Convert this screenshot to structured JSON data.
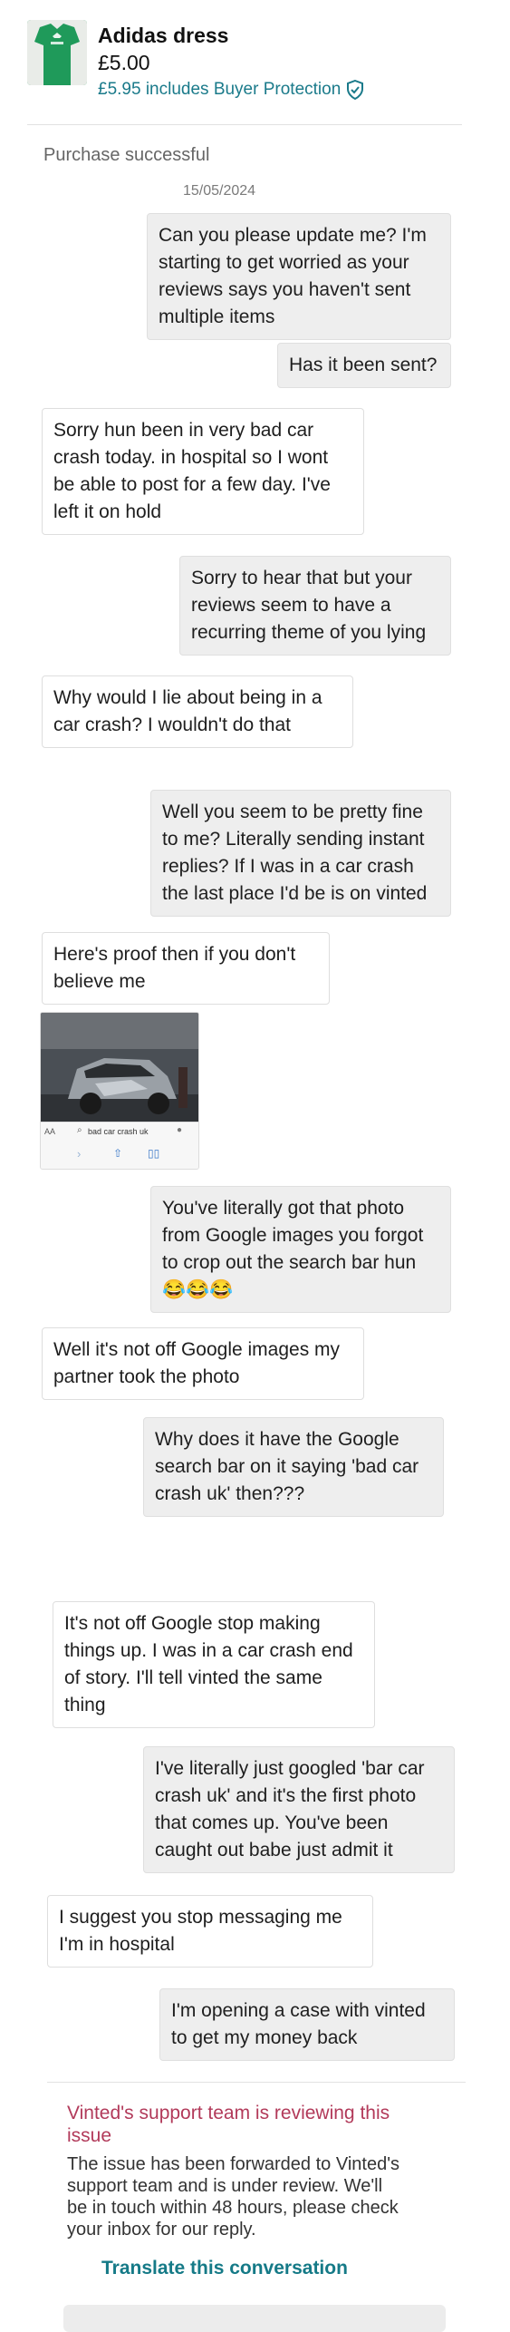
{
  "item": {
    "title": "Adidas dress",
    "price": "£5.00",
    "buyer_protection_text": "£5.95 includes Buyer Protection",
    "thumbnail_color": "#1f9a5a"
  },
  "status": "Purchase successful",
  "date": "15/05/2024",
  "messages": [
    {
      "side": "out",
      "lines": [
        "Can you please update me? I'm",
        "starting to get worried as your",
        "reviews says you haven't sent",
        "multiple items"
      ]
    },
    {
      "side": "out",
      "lines": [
        "Has it been sent?"
      ]
    },
    {
      "side": "in",
      "lines": [
        "Sorry hun been in very bad car",
        "crash today. in hospital so I wont",
        "be able to post for a few day. I've",
        "left it on hold"
      ]
    },
    {
      "side": "out",
      "lines": [
        "Sorry to hear that but your",
        "reviews seem to have a",
        "recurring theme of you lying"
      ]
    },
    {
      "side": "in",
      "lines": [
        "Why would I lie about being in a",
        "car crash? I wouldn't do that"
      ]
    },
    {
      "side": "out",
      "lines": [
        "Well you seem to be pretty fine",
        "to me? Literally sending instant",
        "replies? If I was in a car crash",
        "the last place I'd be is on vinted"
      ]
    },
    {
      "side": "in",
      "lines": [
        "Here's proof then if you don't",
        "believe me"
      ]
    },
    {
      "side": "out",
      "lines": [
        "You've literally got that photo",
        "from Google images you forgot",
        "to crop out the search bar hun",
        "😂😂😂"
      ]
    },
    {
      "side": "in",
      "lines": [
        "Well it's not off Google images my",
        "partner took the photo"
      ]
    },
    {
      "side": "out",
      "lines": [
        "Why does it have the Google",
        "search bar on it saying 'bad car",
        "crash uk' then???"
      ]
    },
    {
      "side": "in",
      "lines": [
        "It's not off Google stop making",
        "things up. I was in a car crash end",
        "of story. I'll tell vinted the same",
        "thing"
      ]
    },
    {
      "side": "out",
      "lines": [
        "I've literally just googled 'bar car",
        "crash uk' and it's the first photo",
        "that comes up. You've been",
        "caught out babe just admit it"
      ]
    },
    {
      "side": "in",
      "lines": [
        "I suggest you stop messaging me",
        "I'm in hospital"
      ]
    },
    {
      "side": "out",
      "lines": [
        "I'm opening a case with vinted",
        "to get my money back"
      ]
    }
  ],
  "photo": {
    "search_text": "bad car crash uk",
    "aa_label": "AA"
  },
  "support": {
    "title_lines": [
      "Vinted's support team is reviewing this",
      "issue"
    ],
    "body_lines": [
      "The issue has been forwarded to Vinted's",
      "support team and is under review. We'll",
      "be in touch within 48 hours, please check",
      "your inbox for our reply."
    ]
  },
  "translate_label": "Translate this conversation",
  "colors": {
    "accent": "#157a87",
    "support_title": "#b23a5a",
    "outgoing_bubble": "#eeeeee"
  }
}
